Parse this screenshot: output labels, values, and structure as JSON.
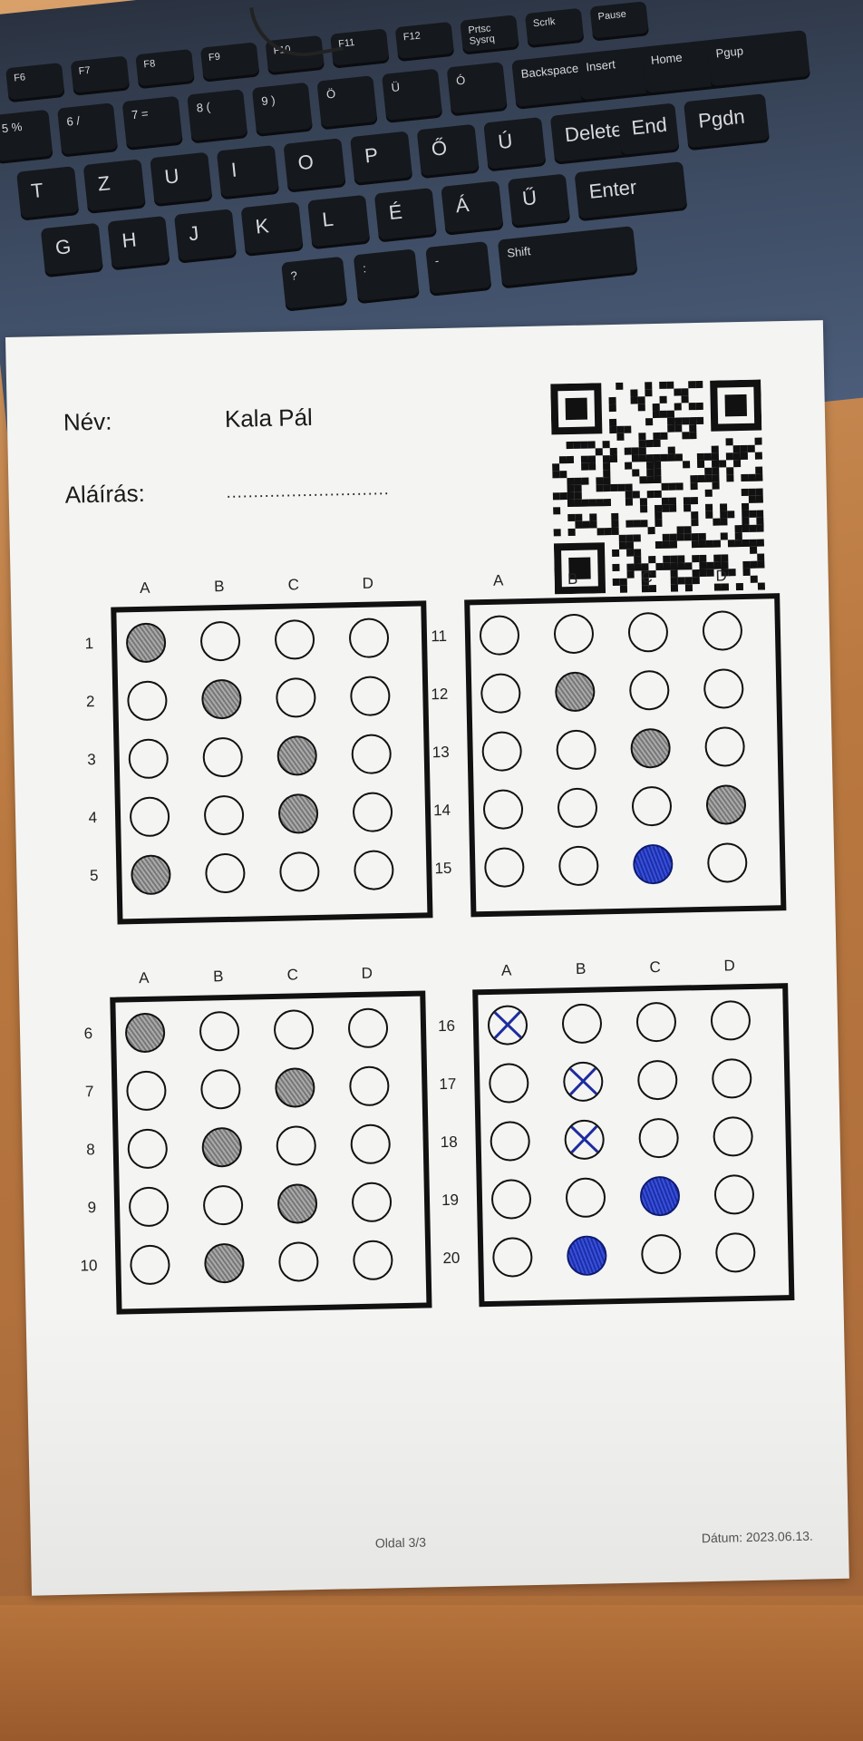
{
  "keyboard": {
    "fn_keys": [
      "F6",
      "F7",
      "F8",
      "F9",
      "F10",
      "F11",
      "F12",
      "Prtsc Sysrq",
      "Scrlk",
      "Pause"
    ],
    "num_keys": [
      "5 %",
      "6 /",
      "7 =",
      "8 (",
      "9 )",
      "Ö",
      "Ü",
      "Ó",
      "Backspace",
      "Insert",
      "Home",
      "Pgup"
    ],
    "top_keys": [
      "T",
      "Z",
      "U",
      "I",
      "O",
      "P",
      "Ő",
      "Ú",
      "Delete",
      "End",
      "Pgdn"
    ],
    "home_keys": [
      "G",
      "H",
      "J",
      "K",
      "L",
      "É",
      "Á",
      "Ű",
      "Enter"
    ],
    "bottom_keys": [
      "?",
      ":",
      "-",
      "Shift"
    ]
  },
  "sheet": {
    "name_label": "Név:",
    "name_value": "Kala Pál",
    "signature_label": "Aláírás:",
    "signature_line": "..............................",
    "page": "Oldal 3/3",
    "date": "Dátum: 2023.06.13."
  },
  "options": [
    "A",
    "B",
    "C",
    "D"
  ],
  "blocks": [
    {
      "rows": [
        {
          "n": "1",
          "marks": [
            "pencil",
            "",
            "",
            ""
          ]
        },
        {
          "n": "2",
          "marks": [
            "",
            "pencil",
            "",
            ""
          ]
        },
        {
          "n": "3",
          "marks": [
            "",
            "",
            "pencil",
            ""
          ]
        },
        {
          "n": "4",
          "marks": [
            "",
            "",
            "pencil",
            ""
          ]
        },
        {
          "n": "5",
          "marks": [
            "pencil",
            "",
            "",
            ""
          ]
        }
      ]
    },
    {
      "rows": [
        {
          "n": "11",
          "marks": [
            "",
            "",
            "",
            ""
          ]
        },
        {
          "n": "12",
          "marks": [
            "",
            "pencil",
            "",
            ""
          ]
        },
        {
          "n": "13",
          "marks": [
            "",
            "",
            "pencil",
            ""
          ]
        },
        {
          "n": "14",
          "marks": [
            "",
            "",
            "",
            "pencil"
          ]
        },
        {
          "n": "15",
          "marks": [
            "",
            "",
            "pen",
            ""
          ]
        }
      ]
    },
    {
      "rows": [
        {
          "n": "6",
          "marks": [
            "pencil",
            "",
            "",
            ""
          ]
        },
        {
          "n": "7",
          "marks": [
            "",
            "",
            "pencil",
            ""
          ]
        },
        {
          "n": "8",
          "marks": [
            "",
            "pencil",
            "",
            ""
          ]
        },
        {
          "n": "9",
          "marks": [
            "",
            "",
            "pencil",
            ""
          ]
        },
        {
          "n": "10",
          "marks": [
            "",
            "pencil",
            "",
            ""
          ]
        }
      ]
    },
    {
      "rows": [
        {
          "n": "16",
          "marks": [
            "x",
            "",
            "",
            ""
          ]
        },
        {
          "n": "17",
          "marks": [
            "",
            "x",
            "",
            ""
          ]
        },
        {
          "n": "18",
          "marks": [
            "",
            "x",
            "",
            ""
          ]
        },
        {
          "n": "19",
          "marks": [
            "",
            "",
            "pen",
            ""
          ]
        },
        {
          "n": "20",
          "marks": [
            "",
            "pen",
            "",
            ""
          ]
        }
      ]
    }
  ]
}
